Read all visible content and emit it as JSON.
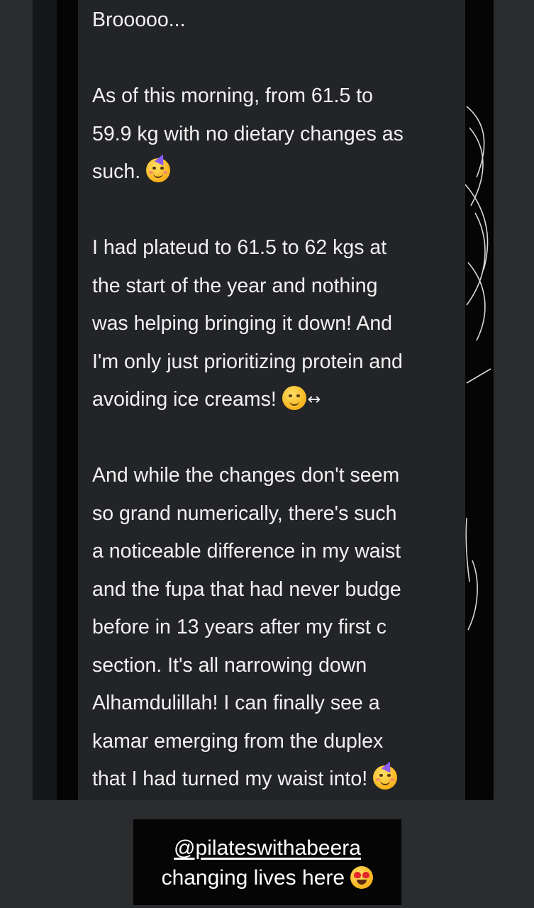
{
  "message": {
    "lines": [
      "Brooooo...",
      "",
      "As of this morning, from 61.5 to",
      "59.9 kg with no dietary changes as",
      "such.",
      "",
      "I had plateud to 61.5 to 62 kgs at",
      "the start of the year and nothing",
      "was helping bringing it down! And",
      "I'm only just prioritizing protein and",
      "avoiding ice creams!",
      "",
      "And while the changes don't seem",
      "so grand numerically, there's such",
      "a noticeable difference in my waist",
      "and the fupa that had never budge",
      "before in 13 years after my first c",
      "section. It's all narrowing down",
      "Alhamdulillah! I can finally see a",
      "kamar emerging from the duplex",
      "that I had turned my waist into!"
    ],
    "emoji_after_line_4": "partying-face-icon",
    "emoji_after_line_10": "slightly-smiling-face-icon",
    "arrow_after_line_10": "↔",
    "emoji_after_line_20": "partying-face-icon"
  },
  "caption": {
    "handle": "@pilateswithabeera",
    "text": "changing lives here",
    "emoji": "heart-eyes-icon"
  }
}
